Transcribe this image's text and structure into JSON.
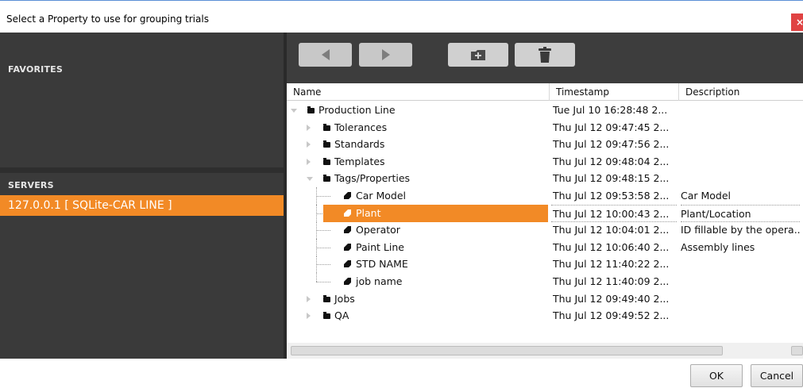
{
  "window": {
    "title": "Select a Property to use for grouping trials",
    "close_label": "×"
  },
  "left": {
    "favorites_header": "FAVORITES",
    "servers_header": "SERVERS",
    "servers": [
      "127.0.0.1 [ SQLite-CAR LINE ]"
    ],
    "selected_server_index": 0
  },
  "toolbar": {
    "back_icon": "triangle-left-icon",
    "forward_icon": "triangle-right-icon",
    "new_folder_icon": "folder-plus-icon",
    "delete_icon": "trash-icon"
  },
  "table": {
    "columns": [
      "Name",
      "Timestamp",
      "Description"
    ],
    "rows": [
      {
        "name": "Production Line",
        "timestamp": "Tue Jul 10 16:28:48 2...",
        "description": "",
        "type": "folder",
        "depth": 0,
        "expanded": true
      },
      {
        "name": "Tolerances",
        "timestamp": "Thu Jul 12 09:47:45 2...",
        "description": "",
        "type": "folder",
        "depth": 1,
        "expanded": false
      },
      {
        "name": "Standards",
        "timestamp": "Thu Jul 12 09:47:56 2...",
        "description": "",
        "type": "folder",
        "depth": 1,
        "expanded": false
      },
      {
        "name": "Templates",
        "timestamp": "Thu Jul 12 09:48:04 2...",
        "description": "",
        "type": "folder",
        "depth": 1,
        "expanded": false
      },
      {
        "name": "Tags/Properties",
        "timestamp": "Thu Jul 12 09:48:15 2...",
        "description": "",
        "type": "folder",
        "depth": 1,
        "expanded": true
      },
      {
        "name": "Car Model",
        "timestamp": "Thu Jul 12 09:53:58 2...",
        "description": "Car Model",
        "type": "tag",
        "depth": 2
      },
      {
        "name": "Plant",
        "timestamp": "Thu Jul 12 10:00:43 2...",
        "description": "Plant/Location",
        "type": "tag",
        "depth": 2,
        "selected": true
      },
      {
        "name": "Operator",
        "timestamp": "Thu Jul 12 10:04:01 2...",
        "description": "ID fillable by the opera...",
        "type": "tag",
        "depth": 2
      },
      {
        "name": "Paint Line",
        "timestamp": "Thu Jul 12 10:06:40 2...",
        "description": "Assembly lines",
        "type": "tag",
        "depth": 2
      },
      {
        "name": "STD NAME",
        "timestamp": "Thu Jul 12 11:40:22 2...",
        "description": "",
        "type": "tag",
        "depth": 2
      },
      {
        "name": "job name",
        "timestamp": "Thu Jul 12 11:40:09 2...",
        "description": "",
        "type": "tag",
        "depth": 2
      },
      {
        "name": "Jobs",
        "timestamp": "Thu Jul 12 09:49:40 2...",
        "description": "",
        "type": "folder",
        "depth": 1,
        "expanded": false
      },
      {
        "name": "QA",
        "timestamp": "Thu Jul 12 09:49:52 2...",
        "description": "",
        "type": "folder",
        "depth": 1,
        "expanded": false
      }
    ]
  },
  "buttons": {
    "ok": "OK",
    "cancel": "Cancel"
  },
  "colors": {
    "accent": "#f28a26",
    "panel_dark": "#3a3a3a",
    "close": "#e04343"
  }
}
